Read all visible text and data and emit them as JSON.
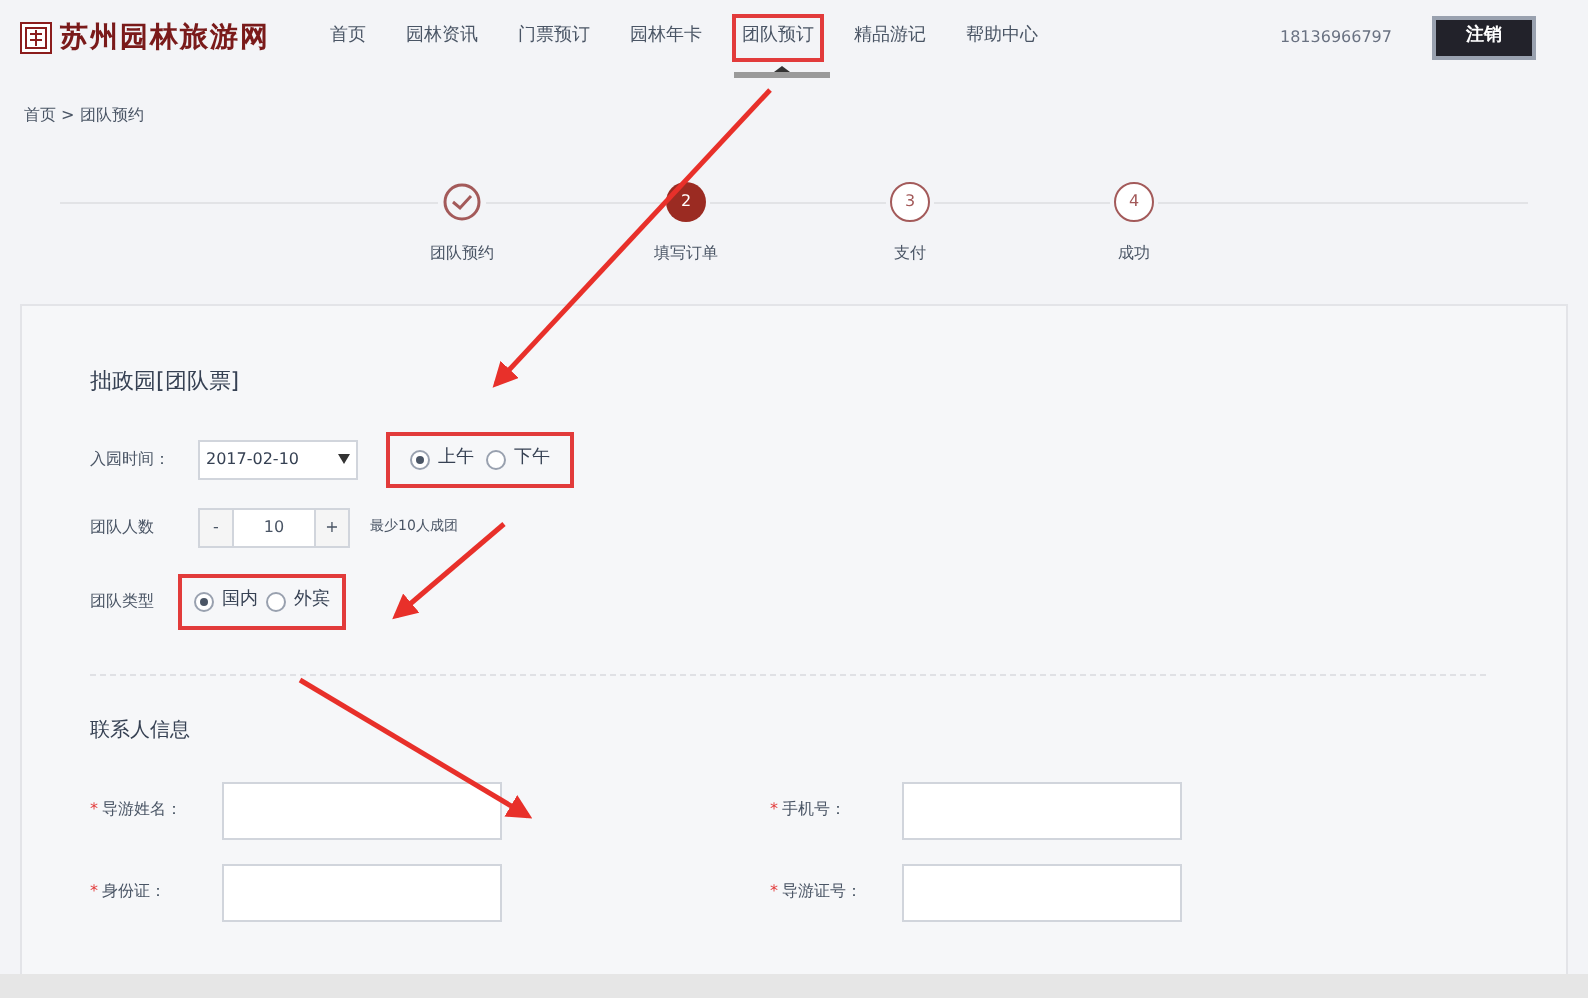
{
  "header": {
    "logo": "苏州园林旅游网",
    "nav": [
      {
        "label": "首页",
        "selected": false
      },
      {
        "label": "园林资讯",
        "selected": false
      },
      {
        "label": "门票预订",
        "selected": false
      },
      {
        "label": "园林年卡",
        "selected": false
      },
      {
        "label": "团队预订",
        "selected": true
      },
      {
        "label": "精品游记",
        "selected": false
      },
      {
        "label": "帮助中心",
        "selected": false
      }
    ],
    "phone": "18136966797",
    "logout": "注销"
  },
  "breadcrumb": "首页 > 团队预约",
  "steps": [
    {
      "label": "团队预约",
      "kind": "done"
    },
    {
      "mark": "2",
      "label": "填写订单",
      "kind": "current"
    },
    {
      "mark": "3",
      "label": "支付",
      "kind": "todo"
    },
    {
      "mark": "4",
      "label": "成功",
      "kind": "todo"
    }
  ],
  "ticket": {
    "title": "拙政园[团队票]",
    "visit_time": {
      "label": "入园时间：",
      "value": "2017-02-10",
      "options": [
        {
          "label": "上午",
          "selected": true
        },
        {
          "label": "下午",
          "selected": false
        }
      ]
    },
    "group_size": {
      "label": "团队人数",
      "minus": "-",
      "value": "10",
      "plus": "+",
      "note": "最少10人成团"
    },
    "group_type": {
      "label": "团队类型",
      "options": [
        {
          "label": "国内",
          "selected": true
        },
        {
          "label": "外宾",
          "selected": false
        }
      ]
    }
  },
  "contact": {
    "title": "联系人信息",
    "fields": [
      {
        "marker": "*",
        "label": "导游姓名："
      },
      {
        "marker": "*",
        "label": "手机号："
      },
      {
        "marker": "*",
        "label": "身份证："
      },
      {
        "marker": "*",
        "label": "导游证号："
      }
    ]
  }
}
